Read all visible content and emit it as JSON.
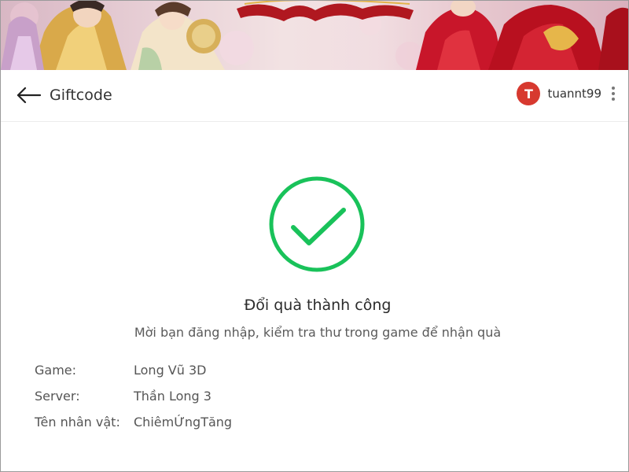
{
  "header": {
    "title": "Giftcode",
    "back_icon": "arrow-left-icon",
    "more_icon": "more-vertical-icon"
  },
  "user": {
    "avatar_letter": "T",
    "avatar_color": "#d7392f",
    "username": "tuannt99"
  },
  "result": {
    "icon": "check-circle-icon",
    "icon_color": "#19c25a",
    "title": "Đổi quà thành công",
    "message": "Mời bạn đăng nhập, kiểm tra thư trong game để nhận quà"
  },
  "info": [
    {
      "label": "Game:",
      "value": "Long Vũ 3D"
    },
    {
      "label": "Server:",
      "value": "Thần Long 3"
    },
    {
      "label": "Tên nhân vật:",
      "value": "ChiêmỨngTăng"
    }
  ]
}
